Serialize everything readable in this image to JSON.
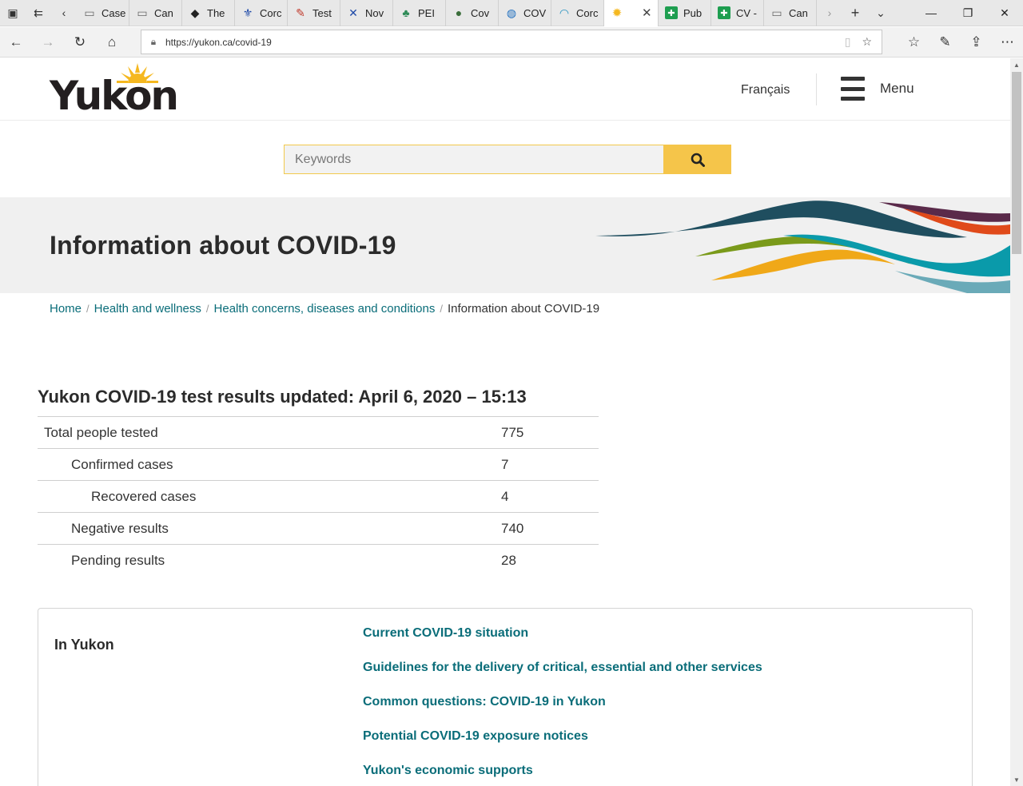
{
  "browser": {
    "tabs": [
      {
        "label": "Case",
        "icon": "page-icon",
        "color": "#666666"
      },
      {
        "label": "Can",
        "icon": "page-icon",
        "color": "#666666"
      },
      {
        "label": "The",
        "icon": "shield-logo-icon",
        "color": "#222222"
      },
      {
        "label": "Corc",
        "icon": "fleur-de-lis-icon",
        "color": "#1f4aa8"
      },
      {
        "label": "Test",
        "icon": "pdf-icon",
        "color": "#c0392b"
      },
      {
        "label": "Nov",
        "icon": "flag-icon",
        "color": "#1f4aa8"
      },
      {
        "label": "PEI",
        "icon": "pei-logo-icon",
        "color": "#2e8b57"
      },
      {
        "label": "Cov",
        "icon": "crest-icon",
        "color": "#3b6e3b"
      },
      {
        "label": "COV",
        "icon": "globe-icon",
        "color": "#1f6fbf"
      },
      {
        "label": "Corc",
        "icon": "wave-icon",
        "color": "#1f8fbf"
      },
      {
        "label": "Pub",
        "icon": "health-cross-icon",
        "color": "#1e9e50"
      },
      {
        "label": "CV -",
        "icon": "health-cross-icon",
        "color": "#1e9e50"
      },
      {
        "label": "Can",
        "icon": "page-icon",
        "color": "#666666"
      }
    ],
    "active_tab": {
      "icon": "yukon-sun-icon",
      "color": "#f5b820"
    },
    "url": "https://yukon.ca/covid-19"
  },
  "header": {
    "logo_text": "Yukon",
    "language_link": "Français",
    "menu_label": "Menu"
  },
  "search": {
    "placeholder": "Keywords",
    "button_color": "#f5c54a"
  },
  "hero": {
    "title": "Information about COVID-19"
  },
  "breadcrumb": {
    "items": [
      "Home",
      "Health and wellness",
      "Health concerns, diseases and conditions"
    ],
    "current": "Information about COVID-19"
  },
  "results": {
    "heading": "Yukon COVID-19 test results updated: April 6, 2020 – 15:13",
    "rows": [
      {
        "label": "Total people tested",
        "value": "775",
        "indent": 0
      },
      {
        "label": "Confirmed cases",
        "value": "7",
        "indent": 1
      },
      {
        "label": "Recovered cases",
        "value": "4",
        "indent": 2
      },
      {
        "label": "Negative results",
        "value": "740",
        "indent": 1
      },
      {
        "label": "Pending results",
        "value": "28",
        "indent": 1
      }
    ]
  },
  "in_yukon": {
    "title": "In Yukon",
    "links": [
      "Current COVID-19 situation",
      "Guidelines for the delivery of critical, essential and other services",
      "Common questions: COVID-19 in Yukon",
      "Potential COVID-19 exposure notices",
      "Yukon's economic supports"
    ]
  },
  "colors": {
    "link": "#0a6d79",
    "accent_yellow": "#f5c54a",
    "wave_dark_teal": "#1f4e5f",
    "wave_teal": "#0a9aaa",
    "wave_green": "#7a9a1a",
    "wave_orange": "#f0a818",
    "wave_red_orange": "#e04a1a",
    "wave_purple": "#5a2a4a"
  }
}
